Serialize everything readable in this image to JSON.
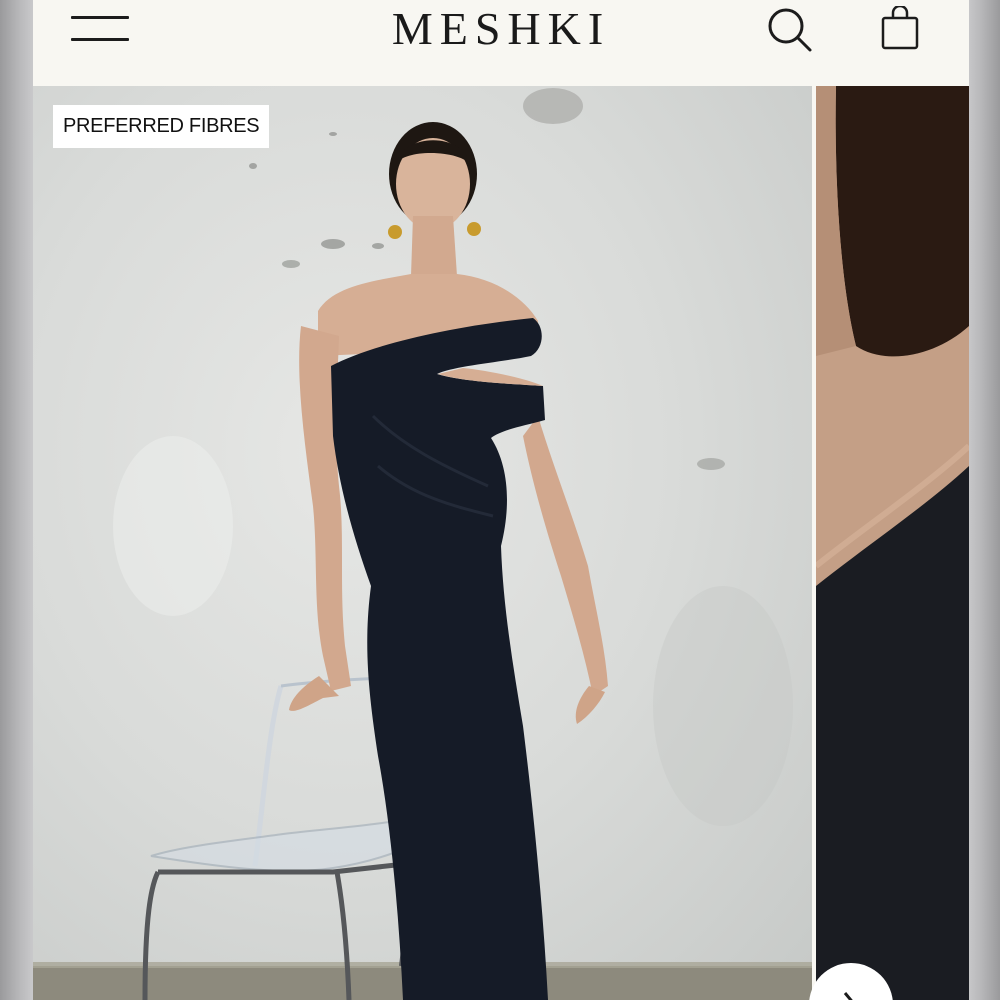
{
  "header": {
    "brand": "MESHKI",
    "icons": {
      "menu": "hamburger-menu-icon",
      "search": "search-icon",
      "bag": "shopping-bag-icon"
    }
  },
  "product_gallery": {
    "badge": "PREFERRED FIBRES",
    "slides": [
      {
        "image": "model-in-black-asymmetric-maxi-dress"
      },
      {
        "image": "dress-neckline-close-up"
      }
    ]
  },
  "colors": {
    "header_bg": "#f8f7f2",
    "text": "#1a1a1a",
    "dress": "#151b27"
  }
}
